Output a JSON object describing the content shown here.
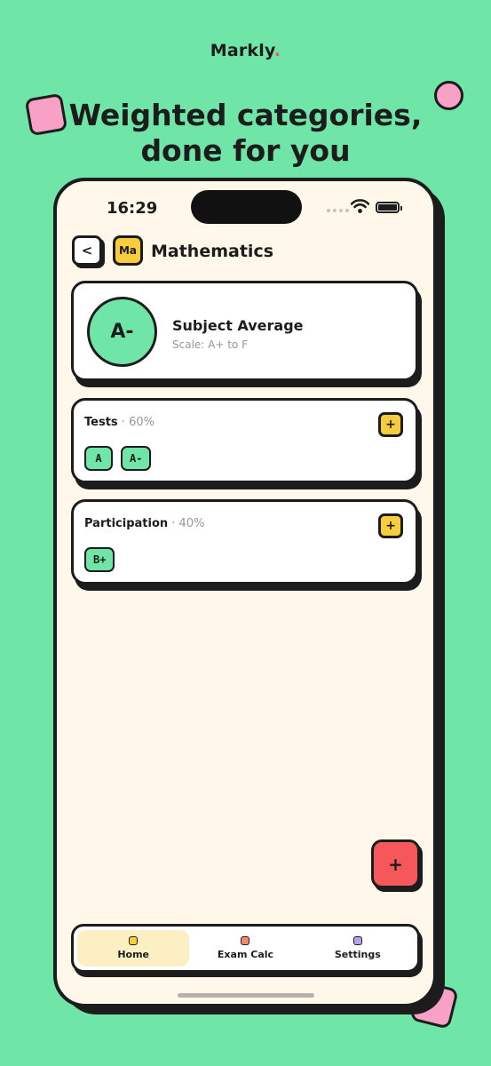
{
  "brand": {
    "name": "Markly",
    "dot": "."
  },
  "headline": {
    "line1": "Weighted categories,",
    "line2": "done for you"
  },
  "status_bar": {
    "time": "16:29"
  },
  "header": {
    "back_label": "<",
    "subject_abbr": "Ma",
    "title": "Mathematics"
  },
  "average": {
    "grade": "A-",
    "label": "Subject Average",
    "scale": "Scale: A+ to F"
  },
  "categories": [
    {
      "name": "Tests",
      "separator": " · ",
      "weight": "60%",
      "add_label": "+",
      "grades": [
        "A",
        "A-"
      ]
    },
    {
      "name": "Participation",
      "separator": " · ",
      "weight": "40%",
      "add_label": "+",
      "grades": [
        "B+"
      ]
    }
  ],
  "fab": {
    "label": "+"
  },
  "tabbar": {
    "tabs": [
      {
        "label": "Home",
        "icon": "home-icon",
        "color": "#f7cc3d",
        "active": true
      },
      {
        "label": "Exam Calc",
        "icon": "calculator-icon",
        "color": "#f28a6a",
        "active": false
      },
      {
        "label": "Settings",
        "icon": "settings-icon",
        "color": "#b99ef2",
        "active": false
      }
    ]
  },
  "colors": {
    "background": "#6fe5a7",
    "phone_surface": "#fff7ea",
    "accent_yellow": "#f7cc3d",
    "accent_green": "#6fe5a7",
    "accent_red": "#f4585a",
    "accent_pink": "#f7a1c6",
    "ink": "#1c1c1c"
  }
}
